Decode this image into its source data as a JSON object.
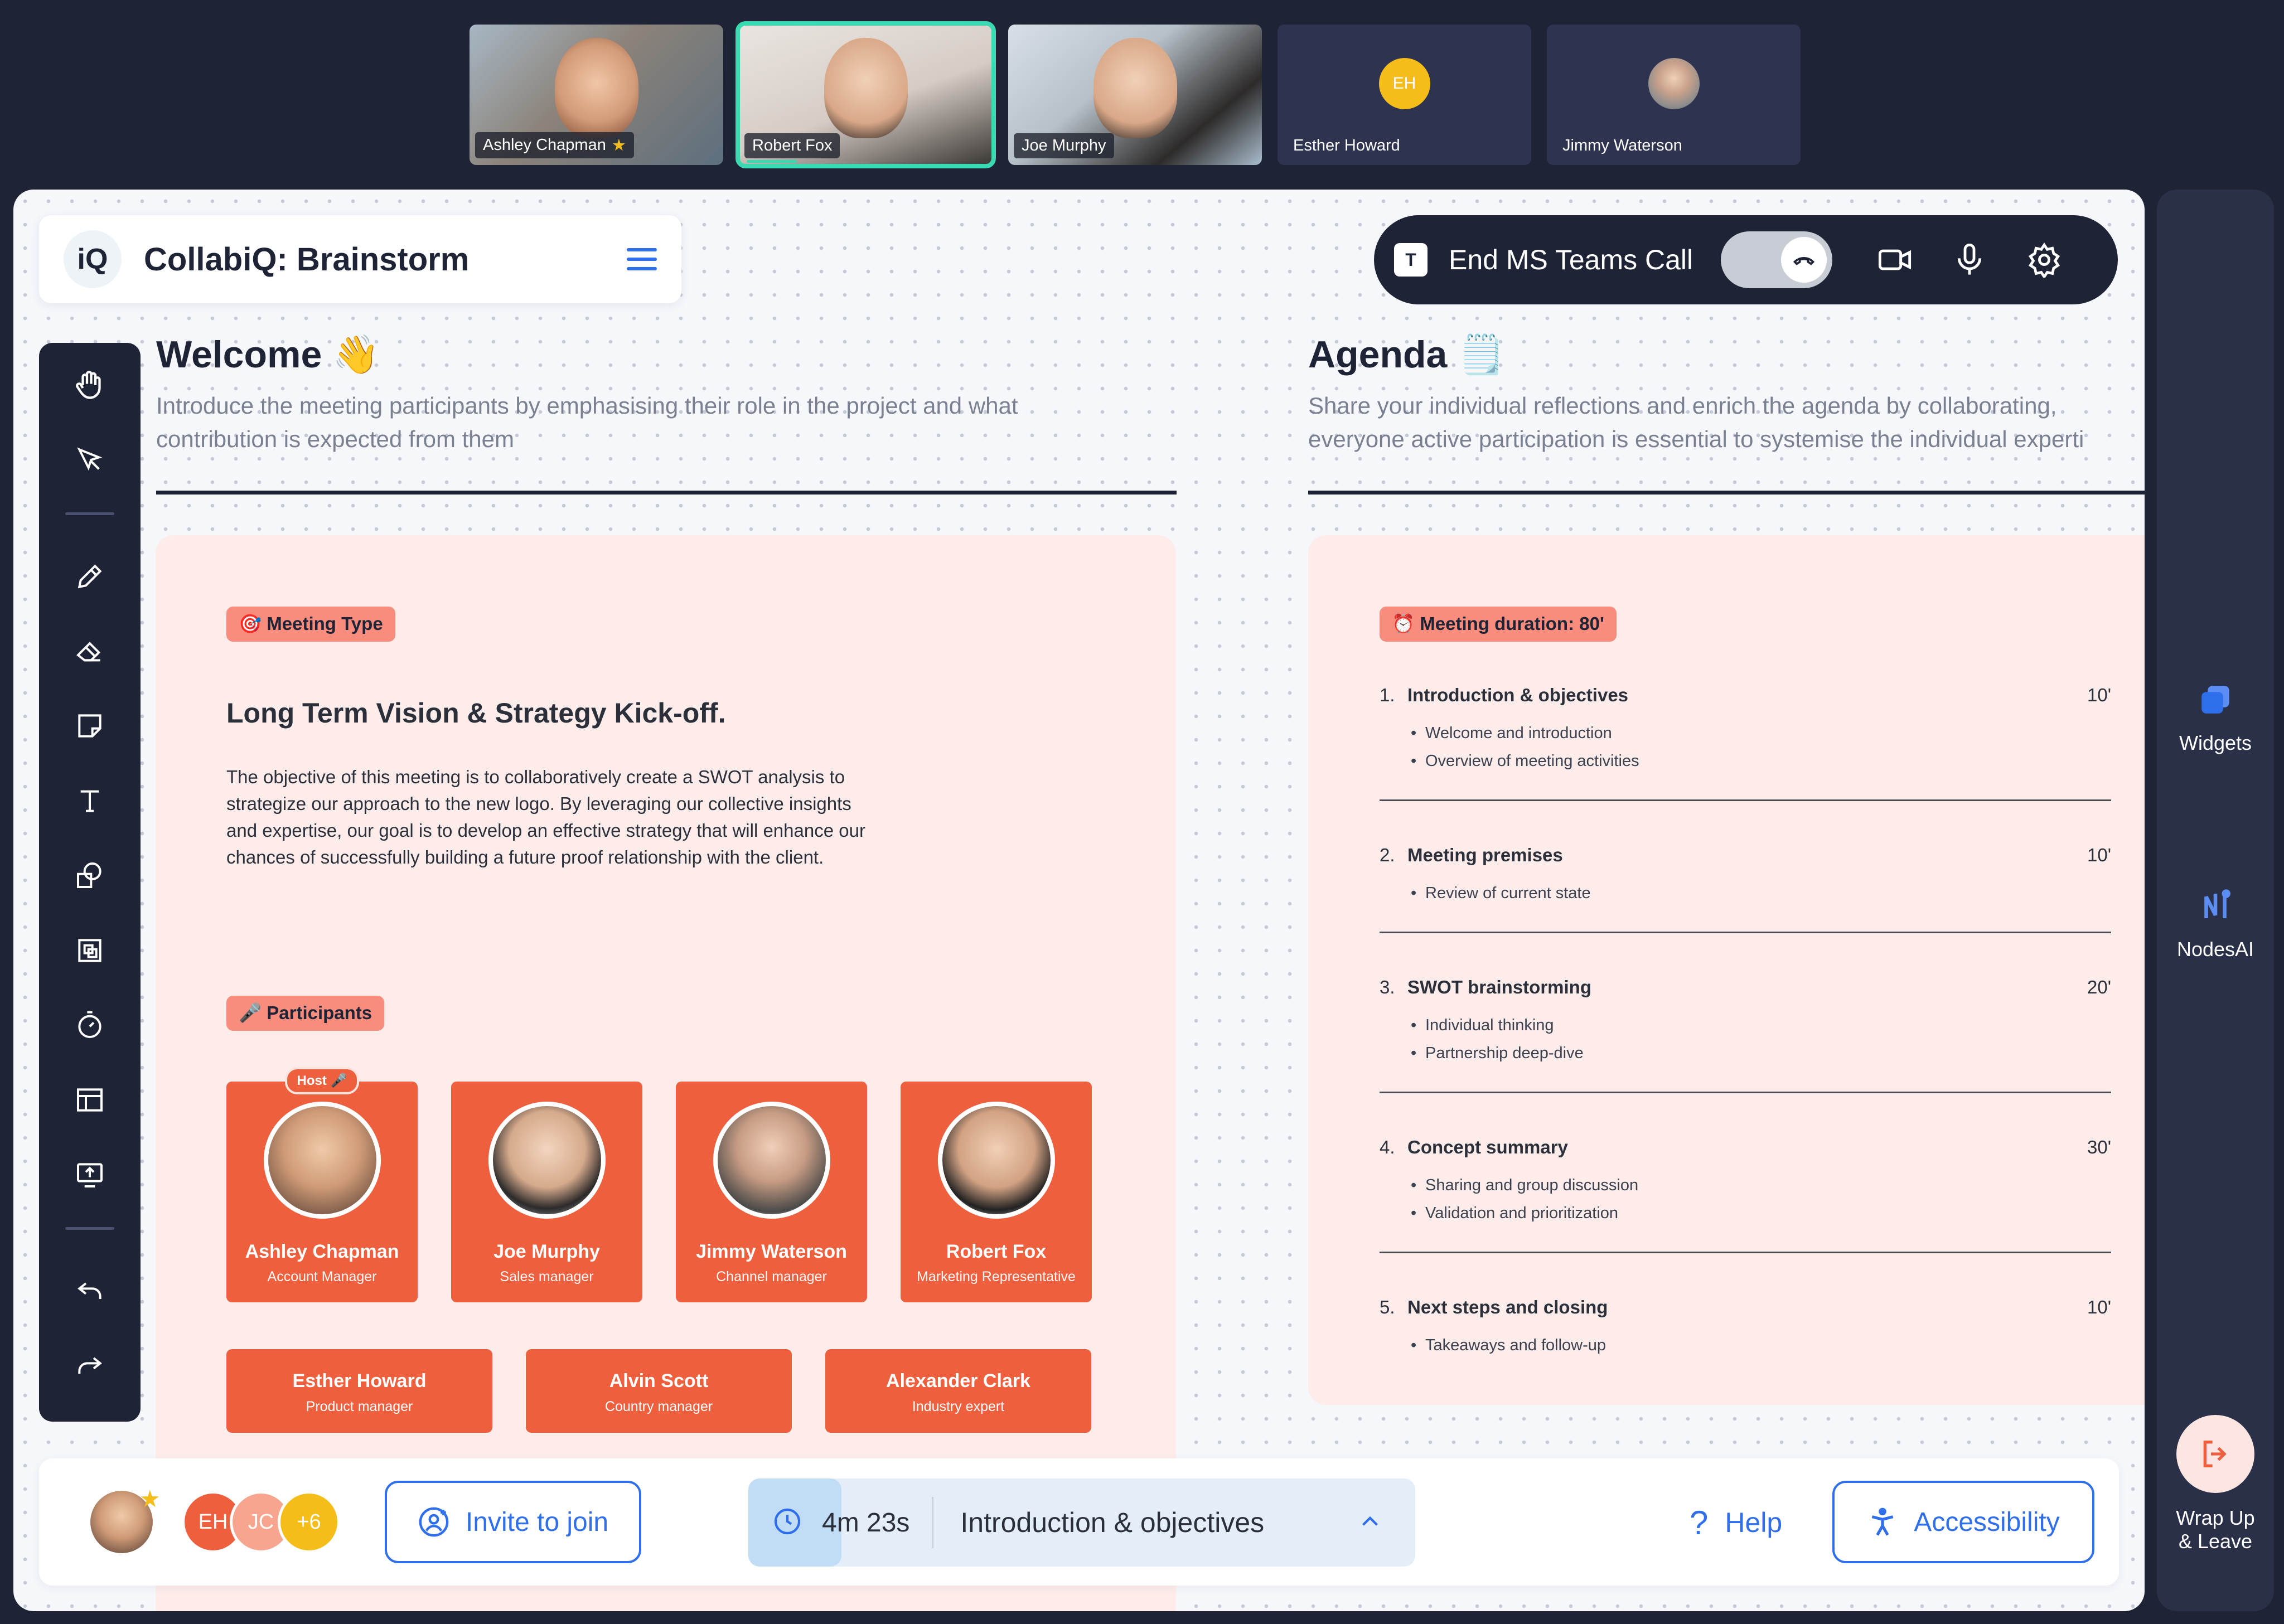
{
  "participants": [
    {
      "name": "Ashley Chapman",
      "star": "★"
    },
    {
      "name": "Robert Fox"
    },
    {
      "name": "Joe Murphy"
    },
    {
      "name": "Esther Howard",
      "initials": "EH"
    },
    {
      "name": "Jimmy Waterson"
    }
  ],
  "header": {
    "logo": "iQ",
    "title": "CollabiQ: Brainstorm"
  },
  "call": {
    "end_label": "End MS Teams Call"
  },
  "welcome": {
    "title": "Welcome 👋",
    "subtitle_line1": "Introduce the meeting participants by emphasising their role in the project and what",
    "subtitle_line2": "contribution is expected from them",
    "meeting_type_label": "🎯 Meeting Type",
    "meeting_title": "Long Term Vision & Strategy Kick-off.",
    "meeting_desc": "The objective of this meeting is to collaboratively create a SWOT analysis to strategize our approach to the new logo. By leveraging our collective insights and expertise, our goal is to develop an effective strategy that will enhance our chances of successfully building a future proof relationship with the client.",
    "participants_label": "🎤 Participants",
    "host_badge": "Host 🎤",
    "people": [
      {
        "name": "Ashley Chapman",
        "role": "Account Manager"
      },
      {
        "name": "Joe Murphy",
        "role": "Sales manager"
      },
      {
        "name": "Jimmy Waterson",
        "role": "Channel manager"
      },
      {
        "name": "Robert Fox",
        "role": "Marketing Representative"
      }
    ],
    "people_extra": [
      {
        "name": "Esther Howard",
        "role": "Product manager"
      },
      {
        "name": "Alvin Scott",
        "role": "Country manager"
      },
      {
        "name": "Alexander Clark",
        "role": "Industry expert"
      }
    ]
  },
  "agenda": {
    "title": "Agenda 🗒️",
    "subtitle_line1": "Share your individual reflections and enrich the agenda by collaborating,",
    "subtitle_line2": "everyone active participation is essential to systemise the individual experti",
    "duration_label": "⏰ Meeting duration: 80'",
    "items": [
      {
        "num": "1.",
        "title": "Introduction & objectives",
        "time": "10'",
        "subs": [
          "Welcome and introduction",
          "Overview of meeting activities"
        ]
      },
      {
        "num": "2.",
        "title": "Meeting premises",
        "time": "10'",
        "subs": [
          "Review of current state"
        ]
      },
      {
        "num": "3.",
        "title": "SWOT brainstorming",
        "time": "20'",
        "subs": [
          "Individual thinking",
          "Partnership deep-dive"
        ]
      },
      {
        "num": "4.",
        "title": "Concept summary",
        "time": "30'",
        "subs": [
          "Sharing and group discussion",
          "Validation and prioritization"
        ]
      },
      {
        "num": "5.",
        "title": "Next steps and closing",
        "time": "10'",
        "subs": [
          "Takeaways and follow-up"
        ]
      }
    ]
  },
  "bottom": {
    "me_star": "★",
    "avatars": [
      {
        "label": "EH",
        "color": "#ee5f3e"
      },
      {
        "label": "JC",
        "color": "#f7a58e"
      },
      {
        "label": "+6",
        "color": "#f4bd1a"
      }
    ],
    "invite_label": "Invite to join",
    "timer_time": "4m 23s",
    "timer_progress": 0.14,
    "timer_step": "Introduction & objectives",
    "help_label": "Help",
    "accessibility_label": "Accessibility"
  },
  "right_rail": {
    "widgets_label": "Widgets",
    "nodes_label": "NodesAI",
    "leave_line1": "Wrap Up",
    "leave_line2": "& Leave"
  },
  "colors": {
    "accent": "#2f6fec",
    "coral": "#ee5f3e",
    "dark": "#1e2436",
    "active_tile": "#39d9b1"
  }
}
